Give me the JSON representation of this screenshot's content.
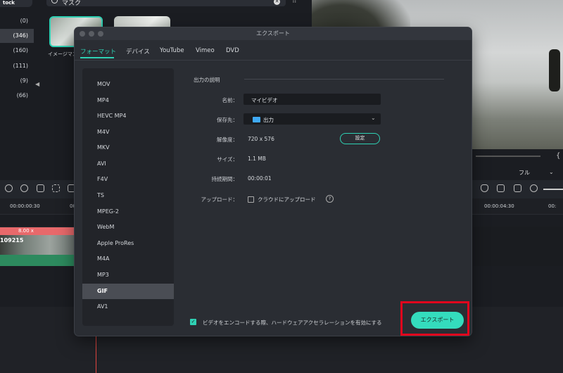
{
  "background": {
    "stock_tab": "tock",
    "categories": [
      "(0)",
      "(346)",
      "(160)",
      "(111)",
      "(9)",
      "(66)"
    ],
    "search_query": "マスク",
    "thumb_label": "イメージマス",
    "timecodes": [
      "00:00:00:30",
      "00:",
      "00:00:04:30",
      "00:"
    ],
    "clip_speed": "8.00 x",
    "clip_id": "109215",
    "view_mode": "フル",
    "brace": "{"
  },
  "dialog": {
    "title": "エクスポート",
    "tabs": [
      "フォーマット",
      "デバイス",
      "YouTube",
      "Vimeo",
      "DVD"
    ],
    "active_tab": "フォーマット",
    "formats": [
      "MOV",
      "MP4",
      "HEVC MP4",
      "M4V",
      "MKV",
      "AVI",
      "F4V",
      "TS",
      "MPEG-2",
      "WebM",
      "Apple ProRes",
      "M4A",
      "MP3",
      "GIF",
      "AV1"
    ],
    "selected_format": "GIF",
    "section_title": "出力の説明",
    "name_label": "名前：",
    "name_value": "マイビデオ",
    "save_label": "保存先：",
    "save_value": "出力",
    "resolution_label": "解像度：",
    "resolution_value": "720 x 576",
    "settings_button": "設定",
    "size_label": "サイズ：",
    "size_value": "1.1 MB",
    "duration_label": "持続期間：",
    "duration_value": "00:00:01",
    "upload_label": "アップロード：",
    "upload_option": "クラウドにアップロード",
    "help": "?",
    "hw_accel_text": "ビデオをエンコードする際、ハードウェアアクセラレーションを有効にする",
    "hw_accel_checked": true,
    "export_button": "エクスポート"
  }
}
